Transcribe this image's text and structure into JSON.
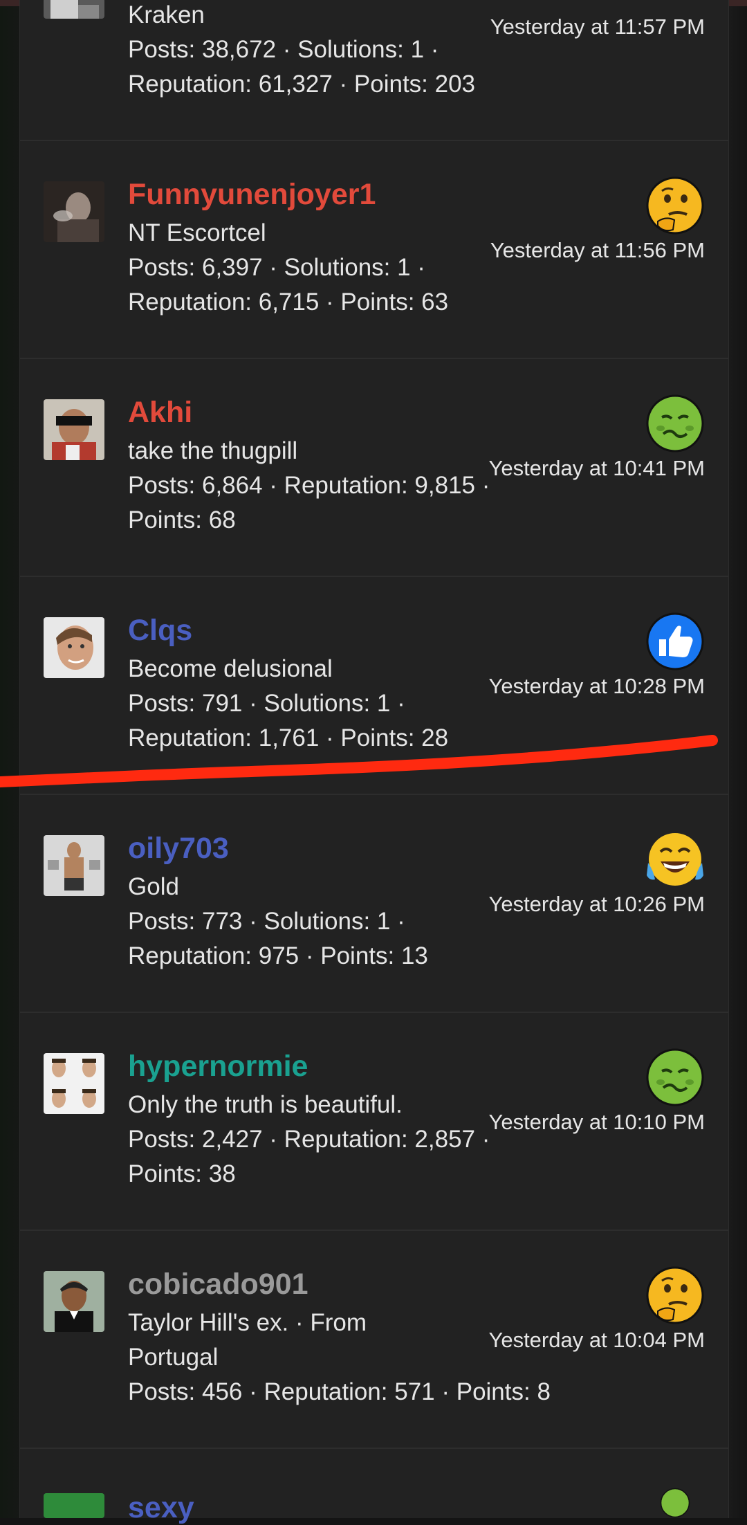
{
  "rows": [
    {
      "name": "",
      "title": "Kraken",
      "stats": "Posts: 38,672 · Solutions: 1 · Reputation: 61,327 · Points: 203",
      "time": "Yesterday at 11:57 PM",
      "name_color": "#e24a3b",
      "reaction": "thinking-face"
    },
    {
      "name": "Funnyunenjoyer1",
      "title": "NT Escortcel",
      "stats": "Posts: 6,397 · Solutions: 1 · Reputation: 6,715 · Points: 63",
      "time": "Yesterday at 11:56 PM",
      "name_color": "#e24a3b",
      "reaction": "thinking-face"
    },
    {
      "name": "Akhi",
      "title": "take the thugpill",
      "stats": "Posts: 6,864 · Reputation: 9,815 · Points: 68",
      "time": "Yesterday at 10:41 PM",
      "name_color": "#e24a3b",
      "reaction": "nauseated-face"
    },
    {
      "name": "Clqs",
      "title": "Become delusional",
      "stats": "Posts: 791 · Solutions: 1 · Reputation: 1,761 · Points: 28",
      "time": "Yesterday at 10:28 PM",
      "name_color": "#4a5fc1",
      "reaction": "thumbs-up"
    },
    {
      "name": "oily703",
      "title": "Gold",
      "stats": "Posts: 773 · Solutions: 1 · Reputation: 975 · Points: 13",
      "time": "Yesterday at 10:26 PM",
      "name_color": "#4a5fc1",
      "reaction": "tears-of-joy"
    },
    {
      "name": "hypernormie",
      "title": "Only the truth is beautiful.",
      "stats": "Posts: 2,427 · Reputation: 2,857 · Points: 38",
      "time": "Yesterday at 10:10 PM",
      "name_color": "#1aa190",
      "reaction": "nauseated-face"
    },
    {
      "name": "cobicado901",
      "title": "Taylor Hill's ex. · From Portugal",
      "stats": "Posts: 456 · Reputation: 571 · Points: 8",
      "time": "Yesterday at 10:04 PM",
      "name_color": "#9a9a9a",
      "reaction": "thinking-face"
    },
    {
      "name": "sexy",
      "title": "",
      "stats": "",
      "time": "",
      "name_color": "#4a5fc1",
      "reaction": "nauseated-face"
    }
  ],
  "colors": {
    "annotation": "#ff2a10",
    "thumbs_up_bg": "#1877f2"
  }
}
